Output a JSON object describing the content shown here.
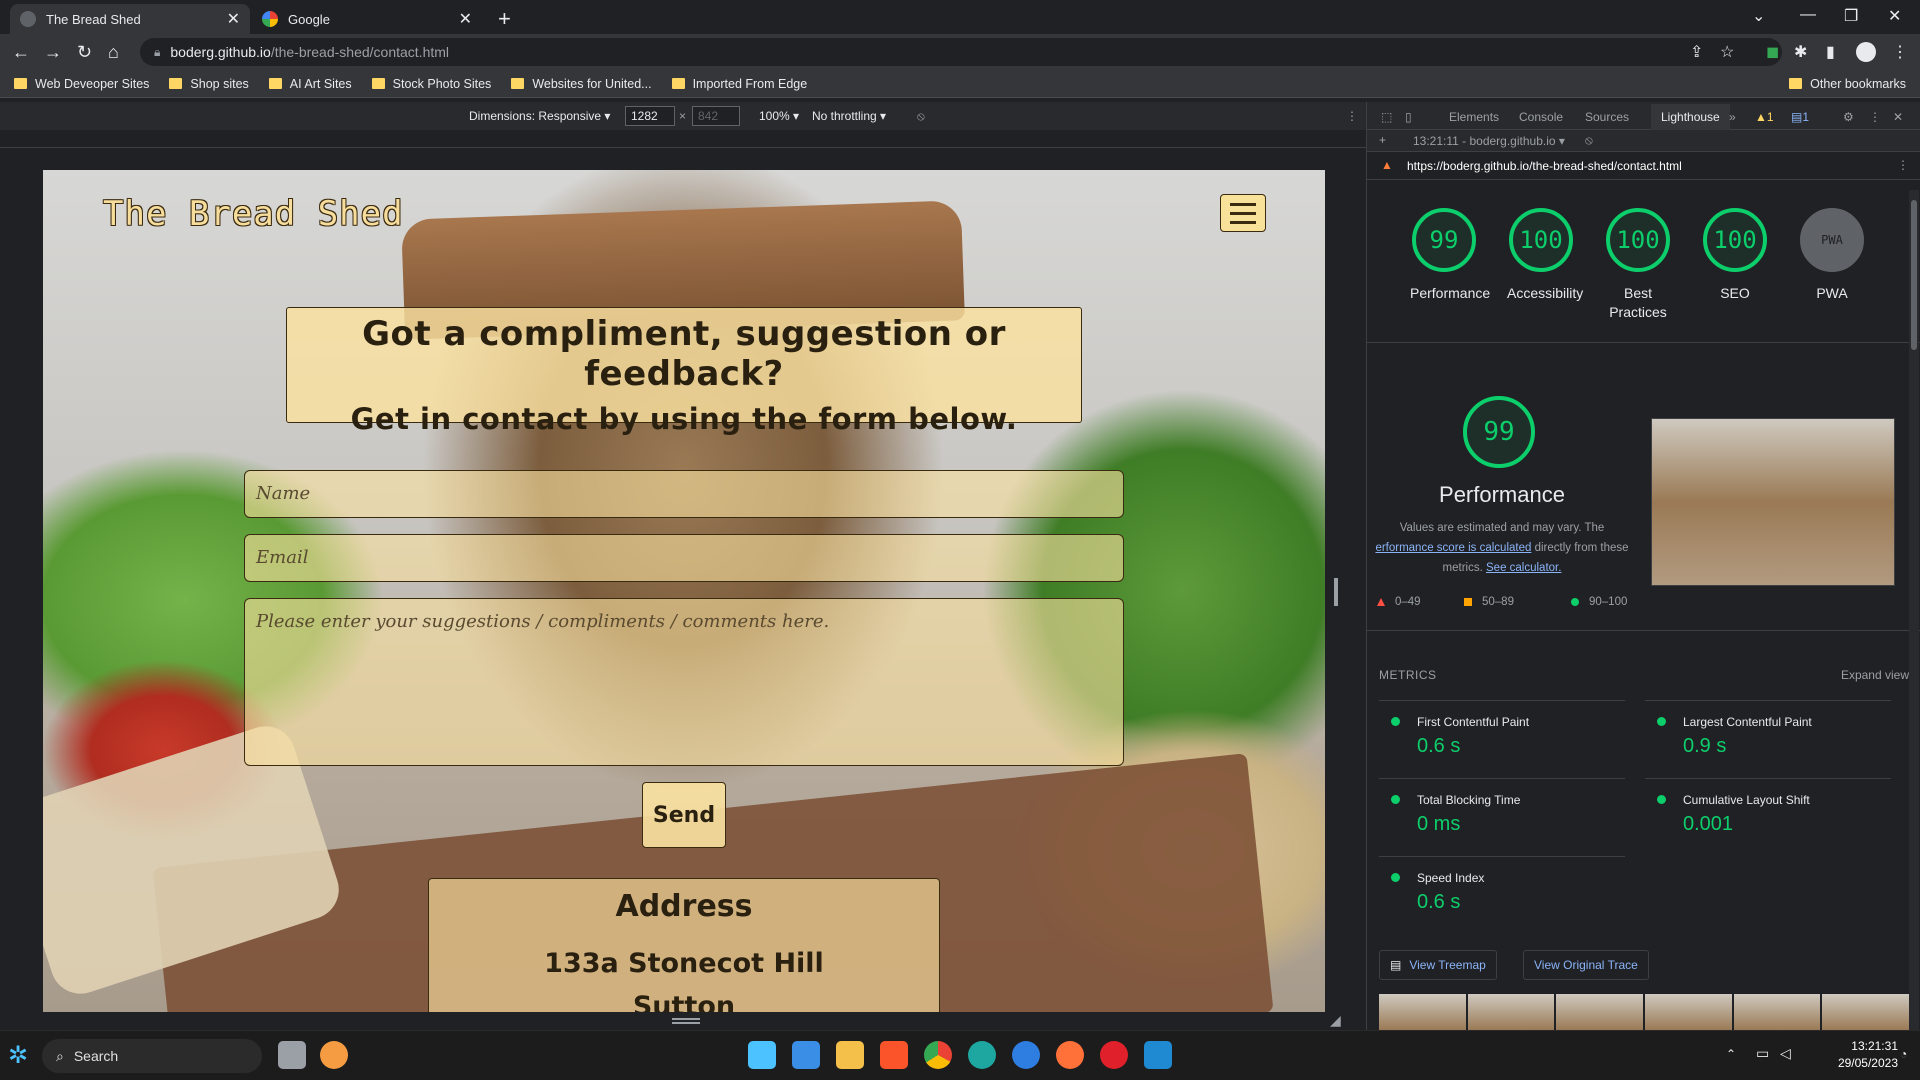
{
  "browser": {
    "tabs": [
      {
        "title": "The Bread Shed",
        "active": true
      },
      {
        "title": "Google",
        "active": false
      }
    ],
    "url_host": "boderg.github.io",
    "url_path": "/the-bread-shed/contact.html",
    "bookmarks": [
      "Web Deveoper Sites",
      "Shop sites",
      "AI Art Sites",
      "Stock Photo Sites",
      "Websites for United...",
      "Imported From Edge"
    ],
    "other_bookmarks": "Other bookmarks"
  },
  "device_toolbar": {
    "dimensions_label": "Dimensions: Responsive",
    "width": "1282",
    "times": "×",
    "height": "842",
    "zoom": "100%",
    "throttling": "No throttling"
  },
  "site": {
    "brand": "The Bread Shed",
    "headline_1": "Got a compliment, suggestion or feedback?",
    "headline_2": "Get in contact by using the form below.",
    "name_placeholder": "Name",
    "email_placeholder": "Email",
    "message_placeholder": "Please enter your suggestions / compliments / comments here.",
    "send_label": "Send",
    "address_title": "Address",
    "address_line_1": "133a Stonecot Hill",
    "address_line_2": "Sutton"
  },
  "devtools": {
    "tabs": [
      "Elements",
      "Console",
      "Sources",
      "Lighthouse"
    ],
    "active_tab": "Lighthouse",
    "warn_count": "1",
    "msg_count": "1",
    "report_label": "13:21:11 - boderg.github.io",
    "report_url": "https://boderg.github.io/the-bread-shed/contact.html",
    "scores": [
      {
        "value": "99",
        "label": "Performance"
      },
      {
        "value": "100",
        "label": "Accessibility"
      },
      {
        "value": "100",
        "label": "Best Practices"
      },
      {
        "value": "100",
        "label": "SEO"
      },
      {
        "value": "PWA",
        "label": "PWA"
      }
    ],
    "perf_score": "99",
    "perf_title": "Performance",
    "perf_note_1": "Values are estimated and may vary. The",
    "perf_note_link": "erformance score is calculated",
    "perf_note_2": "directly from these",
    "perf_note_3": "metrics.",
    "perf_calc_link": "See calculator.",
    "legend": [
      "0–49",
      "50–89",
      "90–100"
    ],
    "metrics_heading": "METRICS",
    "expand_view": "Expand view",
    "metrics": [
      {
        "name": "First Contentful Paint",
        "value": "0.6 s"
      },
      {
        "name": "Largest Contentful Paint",
        "value": "0.9 s"
      },
      {
        "name": "Total Blocking Time",
        "value": "0 ms"
      },
      {
        "name": "Cumulative Layout Shift",
        "value": "0.001"
      },
      {
        "name": "Speed Index",
        "value": "0.6 s"
      }
    ],
    "view_treemap": "View Treemap",
    "view_trace": "View Original Trace",
    "colors": {
      "pass": "#0cce6b",
      "average": "#ffa400",
      "fail": "#ff4e42"
    }
  },
  "taskbar": {
    "search": "Search",
    "time": "13:21:31",
    "date": "29/05/2023"
  }
}
